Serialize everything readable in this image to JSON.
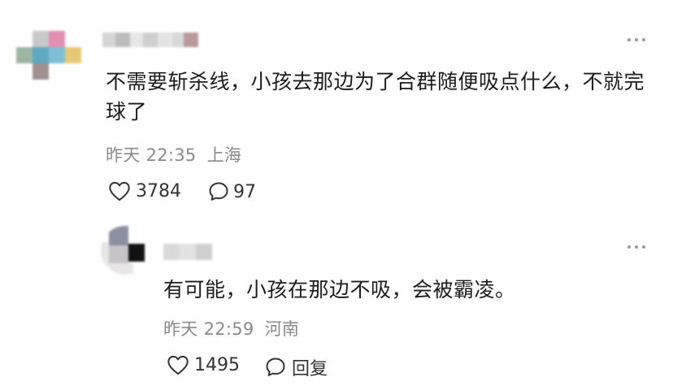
{
  "comment": {
    "text": "不需要斩杀线，小孩去那边为了合群随便吸点什么，不就完球了",
    "time": "昨天 22:35",
    "location": "上海",
    "likes": "3784",
    "replies": "97"
  },
  "reply": {
    "text": "有可能，小孩在那边不吸，会被霸凌。",
    "time": "昨天 22:59",
    "location": "河南",
    "likes": "1495",
    "reply_label": "回复"
  },
  "icons": {
    "like": "heart-outline-icon",
    "comment": "speech-bubble-icon",
    "more": "more-dots-icon"
  }
}
